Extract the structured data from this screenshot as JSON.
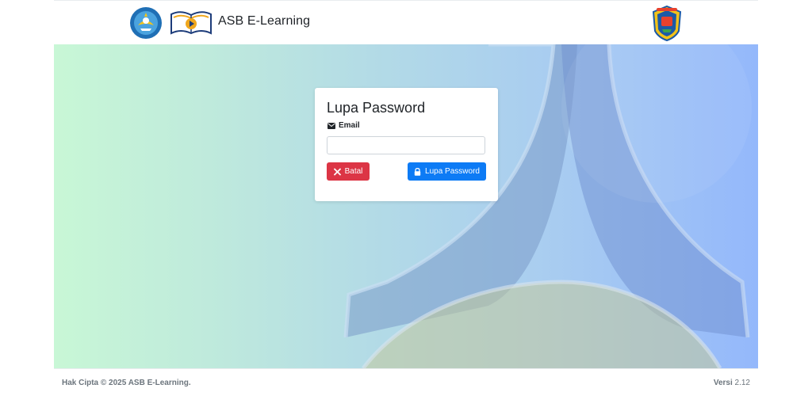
{
  "header": {
    "app_title": "ASB E-Learning"
  },
  "card": {
    "title": "Lupa Password",
    "email_label": "Email",
    "email_value": "",
    "email_placeholder": "",
    "cancel_label": "Batal",
    "submit_label": "Lupa Password"
  },
  "footer": {
    "copyright": "Hak Cipta © 2025 ASB E-Learning.",
    "version_label": "Versi",
    "version_number": "2.12"
  },
  "icons": {
    "email": "envelope-icon",
    "cancel": "times-icon",
    "submit": "lock-icon"
  },
  "colors": {
    "cancel_button": "#dc3545",
    "submit_button": "#0d7bf5",
    "gradient_start": "#c8f7d6",
    "gradient_end": "#94b8fb"
  }
}
